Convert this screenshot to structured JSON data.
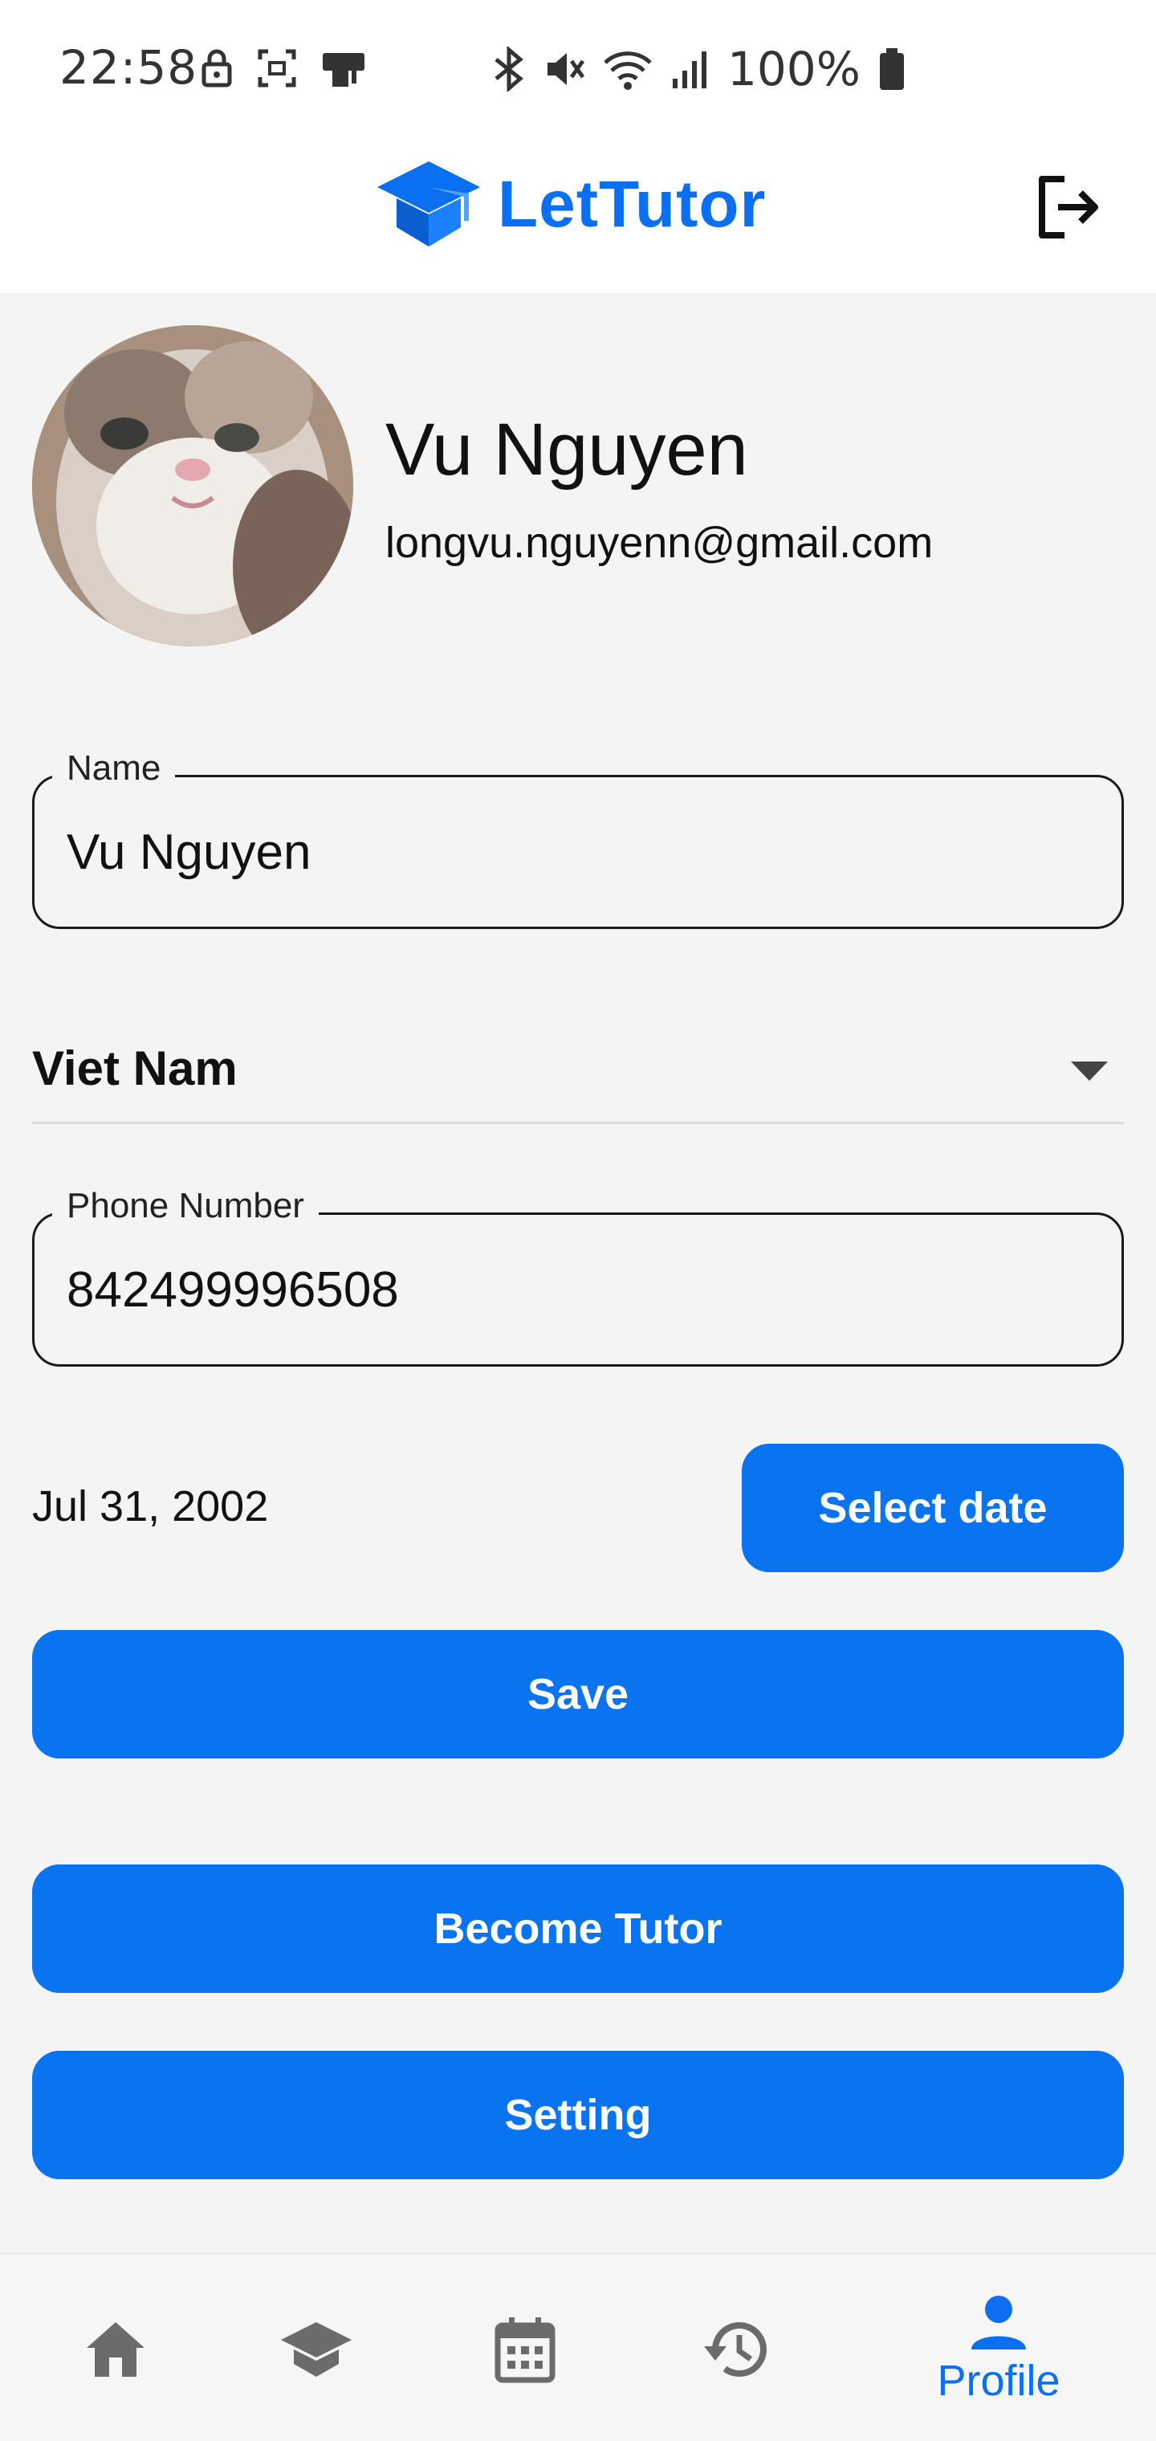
{
  "status_bar": {
    "time": "22:58",
    "battery": "100%"
  },
  "app_bar": {
    "title": "LetTutor",
    "brand_color": "#0a6ff0"
  },
  "profile": {
    "name": "Vu Nguyen",
    "email": "longvu.nguyenn@gmail.com"
  },
  "form": {
    "name_label": "Name",
    "name_value": "Vu Nguyen",
    "country_value": "Viet Nam",
    "phone_label": "Phone Number",
    "phone_value": "842499996508",
    "birthday_value": "Jul 31, 2002",
    "select_date_label": "Select date",
    "save_label": "Save"
  },
  "actions": {
    "become_tutor_label": "Become Tutor",
    "setting_label": "Setting"
  },
  "bottom_nav": {
    "items": [
      {
        "icon": "home-icon",
        "label": ""
      },
      {
        "icon": "graduation-cap-icon",
        "label": ""
      },
      {
        "icon": "calendar-icon",
        "label": ""
      },
      {
        "icon": "history-icon",
        "label": ""
      },
      {
        "icon": "person-icon",
        "label": "Profile"
      }
    ],
    "active_index": 4,
    "active_color": "#0a6ff0",
    "inactive_color": "#6b6b6b"
  }
}
